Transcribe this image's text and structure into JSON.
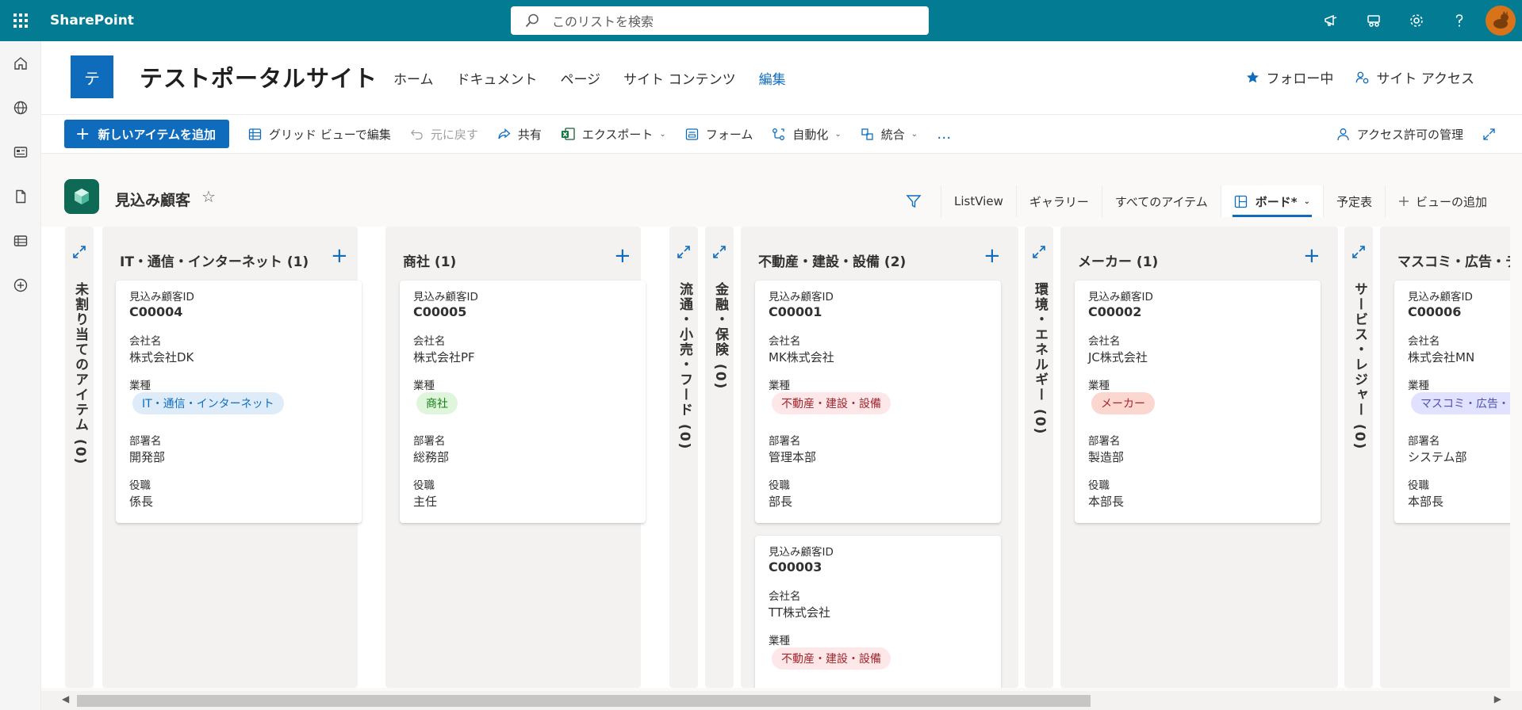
{
  "suitebar": {
    "brand": "SharePoint",
    "search_placeholder": "このリストを検索",
    "icons": [
      "megaphone-icon",
      "share-icon",
      "gear-icon",
      "help-icon",
      "avatar"
    ]
  },
  "site": {
    "logo_letter": "テ",
    "title": "テストポータルサイト",
    "nav": [
      "ホーム",
      "ドキュメント",
      "ページ",
      "サイト コンテンツ",
      "編集"
    ],
    "follow": "フォロー中",
    "site_access": "サイト アクセス"
  },
  "commands": {
    "new_item": "新しいアイテムを追加",
    "grid_edit": "グリッド ビューで編集",
    "undo": "元に戻す",
    "share": "共有",
    "export": "エクスポート",
    "forms": "フォーム",
    "automate": "自動化",
    "integrate": "統合",
    "more": "…",
    "manage_access": "アクセス許可の管理"
  },
  "list": {
    "title": "見込み顧客",
    "views": [
      "ListView",
      "ギャラリー",
      "すべてのアイテム"
    ],
    "active_view": "ボード*",
    "calendar_view": "予定表",
    "add_view": "ビューの追加"
  },
  "labels": {
    "id": "見込み顧客ID",
    "company": "会社名",
    "industry": "業種",
    "department": "部署名",
    "title": "役職"
  },
  "board": {
    "collapsed": [
      {
        "label": "未割り当てのアイテム (0)"
      },
      {
        "label": "流通・小売・フード (0)"
      },
      {
        "label": "金融・保険 (0)"
      },
      {
        "label": "環境・エネルギー (0)"
      },
      {
        "label": "サービス・レジャー (0)"
      }
    ],
    "lanes": [
      {
        "title": "IT・通信・インターネット (1)",
        "cards": [
          {
            "id": "C00004",
            "company": "株式会社DK",
            "industry": "IT・通信・インターネット",
            "department": "開発部",
            "title": "係長"
          }
        ]
      },
      {
        "title": "商社 (1)",
        "cards": [
          {
            "id": "C00005",
            "company": "株式会社PF",
            "industry": "商社",
            "department": "総務部",
            "title": "主任"
          }
        ]
      },
      {
        "title": "不動産・建設・設備 (2)",
        "cards": [
          {
            "id": "C00001",
            "company": "MK株式会社",
            "industry": "不動産・建設・設備",
            "department": "管理本部",
            "title": "部長"
          },
          {
            "id": "C00003",
            "company": "TT株式会社",
            "industry": "不動産・建設・設備"
          }
        ]
      },
      {
        "title": "メーカー (1)",
        "cards": [
          {
            "id": "C00002",
            "company": "JC株式会社",
            "industry": "メーカー",
            "department": "製造部",
            "title": "本部長"
          }
        ]
      },
      {
        "title": "マスコミ・広告・デザイ",
        "cards": [
          {
            "id": "C00006",
            "company": "株式会社MN",
            "industry": "マスコミ・広告・デザ",
            "department": "システム部",
            "title": "本部長"
          }
        ]
      }
    ]
  },
  "colors": {
    "suitebar": "#037c93",
    "accent": "#0f6cbd",
    "pill_it_bg": "#deecf9",
    "pill_it_fg": "#0f6cbd",
    "pill_shosha_bg": "#dff6dd",
    "pill_shosha_fg": "#107c10",
    "pill_realestate_bg": "#fde7e9",
    "pill_realestate_fg": "#a4262c",
    "pill_maker_bg": "#fcd7d0",
    "pill_maker_fg": "#a4262c",
    "pill_media_bg": "#e0e2ff",
    "pill_media_fg": "#4f52b2"
  }
}
